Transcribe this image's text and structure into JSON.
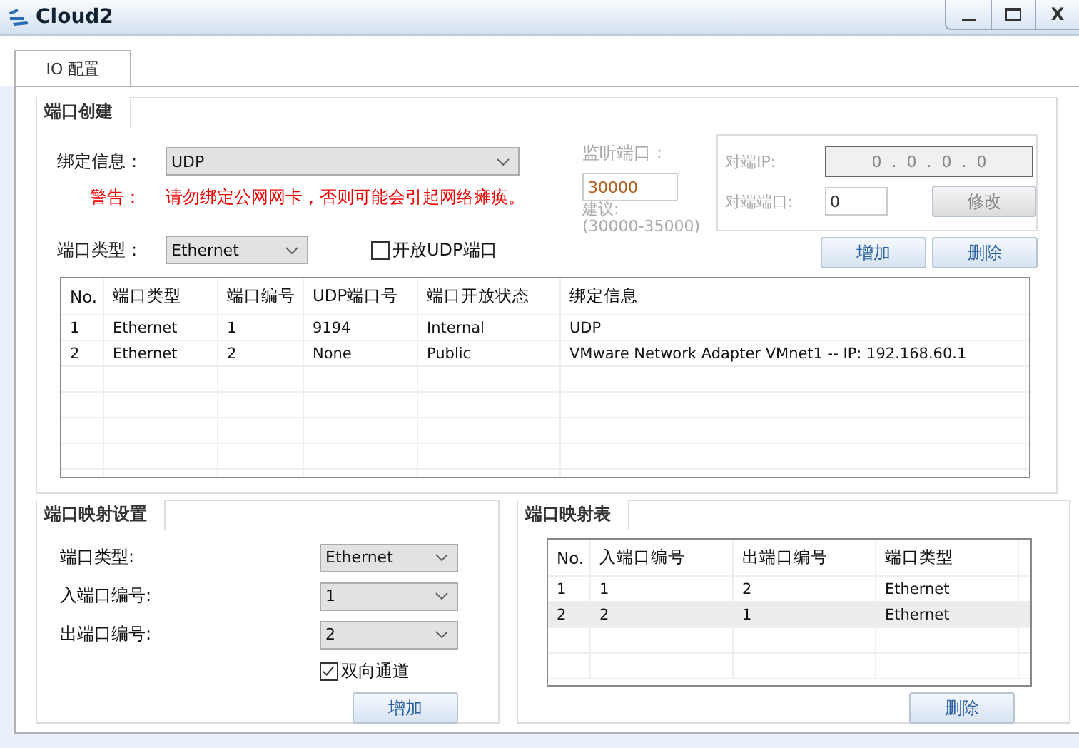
{
  "window": {
    "title": "Cloud2",
    "close_label": "X"
  },
  "tabs": [
    {
      "label": "IO 配置",
      "selected": true
    }
  ],
  "port_creation": {
    "title": "端口创建",
    "binding_label": "绑定信息：",
    "binding_value": "UDP",
    "warning_label": "警告：",
    "warning_text": "请勿绑定公网网卡，否则可能会引起网络瘫痪。",
    "port_type_label": "端口类型：",
    "port_type_value": "Ethernet",
    "open_udp": {
      "label": "开放UDP端口",
      "checked": false
    },
    "listen": {
      "label": "监听端口：",
      "value": "30000",
      "hint": "建议:",
      "range": "(30000-35000)",
      "disabled": true
    },
    "peer": {
      "ip_label": "对端IP:",
      "ip_value": "0  .  0  .  0  .  0",
      "port_label": "对端端口:",
      "port_value": "0",
      "modify_button": "修改",
      "disabled": true
    },
    "add_button": "增加",
    "delete_button": "删除",
    "table": {
      "columns": [
        "No.",
        "端口类型",
        "端口编号",
        "UDP端口号",
        "端口开放状态",
        "绑定信息"
      ],
      "rows": [
        [
          "1",
          "Ethernet",
          "1",
          "9194",
          "Internal",
          "UDP"
        ],
        [
          "2",
          "Ethernet",
          "2",
          "None",
          "Public",
          "VMware Network Adapter VMnet1 -- IP: 192.168.60.1"
        ]
      ]
    }
  },
  "mapping_settings": {
    "title": "端口映射设置",
    "fields": [
      {
        "label": "端口类型:",
        "value": "Ethernet"
      },
      {
        "label": "入端口编号:",
        "value": "1"
      },
      {
        "label": "出端口编号:",
        "value": "2"
      }
    ],
    "bidirectional": {
      "label": "双向通道",
      "checked": true
    },
    "add_button": "增加"
  },
  "mapping_table": {
    "title": "端口映射表",
    "columns": [
      "No.",
      "入端口编号",
      "出端口编号",
      "端口类型"
    ],
    "rows": [
      {
        "cells": [
          "1",
          "1",
          "2",
          "Ethernet"
        ],
        "selected": false
      },
      {
        "cells": [
          "2",
          "2",
          "1",
          "Ethernet"
        ],
        "selected": true
      }
    ],
    "delete_button": "删除"
  }
}
